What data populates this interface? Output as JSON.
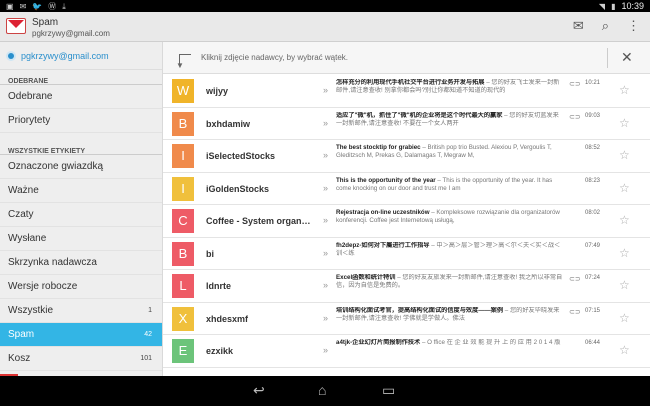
{
  "status": {
    "time": "10:39",
    "left_icons": [
      "notification-icon",
      "email-icon",
      "twitter-icon",
      "wordpress-icon",
      "download-icon"
    ]
  },
  "actionbar": {
    "title": "Spam",
    "account": "pgkrzywy@gmail.com"
  },
  "sidebar": {
    "account": "pgkrzywy@gmail.com",
    "received_header": "ODEBRANE",
    "received": [
      {
        "label": "Odebrane",
        "count": ""
      },
      {
        "label": "Priorytety",
        "count": ""
      }
    ],
    "labels_header": "WSZYSTKIE ETYKIETY",
    "labels": [
      {
        "label": "Oznaczone gwiazdką",
        "count": ""
      },
      {
        "label": "Ważne",
        "count": ""
      },
      {
        "label": "Czaty",
        "count": ""
      },
      {
        "label": "Wysłane",
        "count": ""
      },
      {
        "label": "Skrzynka nadawcza",
        "count": ""
      },
      {
        "label": "Wersje robocze",
        "count": ""
      },
      {
        "label": "Wszystkie",
        "count": "1"
      },
      {
        "label": "Spam",
        "count": "42"
      },
      {
        "label": "Kosz",
        "count": "101"
      }
    ]
  },
  "hint": {
    "text": "Kliknij zdjęcie nadawcy, by wybrać wątek."
  },
  "messages": [
    {
      "letter": "W",
      "color": "#f0b429",
      "sender": "wijyy",
      "subject": "怎样充分的利用现代手机社交平台进行业务开发与拓展",
      "preview": " – 您的好友飞士发来一封新邮件,请注意查收! 别拿你都会吗?别让你都知道不知道的现代的",
      "attach": true,
      "time": "10:21"
    },
    {
      "letter": "B",
      "color": "#f08a4b",
      "sender": "bxhdamiw",
      "subject": "适应了\"微\"机，抓住了\"微\"机的企业将是这个时代最大的赢家",
      "preview": " – 您的好友切蓝发来一封新邮件,请注意查收! 不要在一个女人两开",
      "attach": true,
      "time": "09:03"
    },
    {
      "letter": "I",
      "color": "#f08a4b",
      "sender": "iSelectedStocks",
      "subject": "The best stocktip for grabiec",
      "preview": " – British pop trio Busted. Alexiou P, Vergoulis T, Gleditzsch M, Prekas G, Dalamagas T, Megraw M,",
      "attach": false,
      "time": "08:52"
    },
    {
      "letter": "I",
      "color": "#f0c03c",
      "sender": "iGoldenStocks",
      "subject": "This is the opportunity of the year",
      "preview": " – This is the opportunity of the year. It has come knocking on our door and trust me I am",
      "attach": false,
      "time": "08:23"
    },
    {
      "letter": "C",
      "color": "#ee5b66",
      "sender": "Coffee - System organi...",
      "subject": "Rejestracja on-line uczestników",
      "preview": " – Kompleksowe rozwiązanie dla organizatorów konferencji. Coffee jest Internetową usługą,",
      "attach": false,
      "time": "08:02"
    },
    {
      "letter": "B",
      "color": "#ee5b66",
      "sender": "bi",
      "subject": "fh2depz-如何对下屬进行工作指导",
      "preview": " – 中＞高＞层＞管＞理＞高＜尔＜夫＜实＜战＜训＜练",
      "attach": false,
      "time": "07:49"
    },
    {
      "letter": "L",
      "color": "#ee5b66",
      "sender": "ldnrte",
      "subject": "Excel函数和统计特训",
      "preview": " – 您的好友友旅发来一封新邮件,请注意查收! 我之所以非常自信，因为自信是免费的。",
      "attach": true,
      "time": "07:24"
    },
    {
      "letter": "X",
      "color": "#f0c03c",
      "sender": "xhdesxmf",
      "subject": "培训结构化面试考官，提高结构化面试的信度与效度——案例",
      "preview": " – 您的好友毕晓发来一封新邮件,请注意查收! 学佛就是学做人。佛法",
      "attach": true,
      "time": "07:15"
    },
    {
      "letter": "E",
      "color": "#6cc47a",
      "sender": "ezxikk",
      "subject": "a4tjk-企业幻灯片简报制作技术",
      "preview": " – O ffice 在 企 业 效 能 提 升 上 的 应 用 2 0 1 4 版",
      "attach": false,
      "time": "06:44"
    }
  ]
}
